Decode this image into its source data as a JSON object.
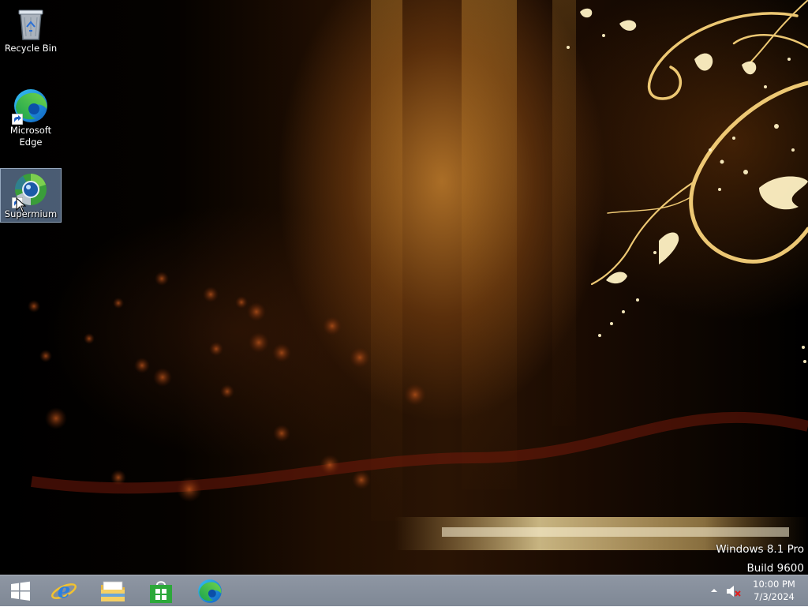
{
  "desktop": {
    "icons": [
      {
        "label": "Recycle Bin",
        "icon": "recycle-bin-icon",
        "selected": false
      },
      {
        "label": "Microsoft Edge",
        "icon": "edge-icon",
        "selected": false
      },
      {
        "label": "Supermium",
        "icon": "supermium-icon",
        "selected": true
      }
    ],
    "watermark": {
      "edition": "Windows 8.1 Pro",
      "build": "Build 9600"
    }
  },
  "taskbar": {
    "buttons": [
      {
        "name": "Start",
        "icon": "windows-start-icon"
      },
      {
        "name": "Internet Explorer",
        "icon": "internet-explorer-icon"
      },
      {
        "name": "File Explorer",
        "icon": "file-explorer-icon"
      },
      {
        "name": "Store",
        "icon": "store-icon"
      },
      {
        "name": "Microsoft Edge",
        "icon": "edge-icon"
      }
    ],
    "tray": {
      "show_hidden_icon": "chevron-up-icon",
      "volume_icon": "volume-muted-icon",
      "time": "10:00 PM",
      "date": "7/3/2024"
    }
  },
  "colors": {
    "taskbar": "#8a929f",
    "selection": "#a5cdff",
    "wallpaper_glow": "#f0c060"
  }
}
